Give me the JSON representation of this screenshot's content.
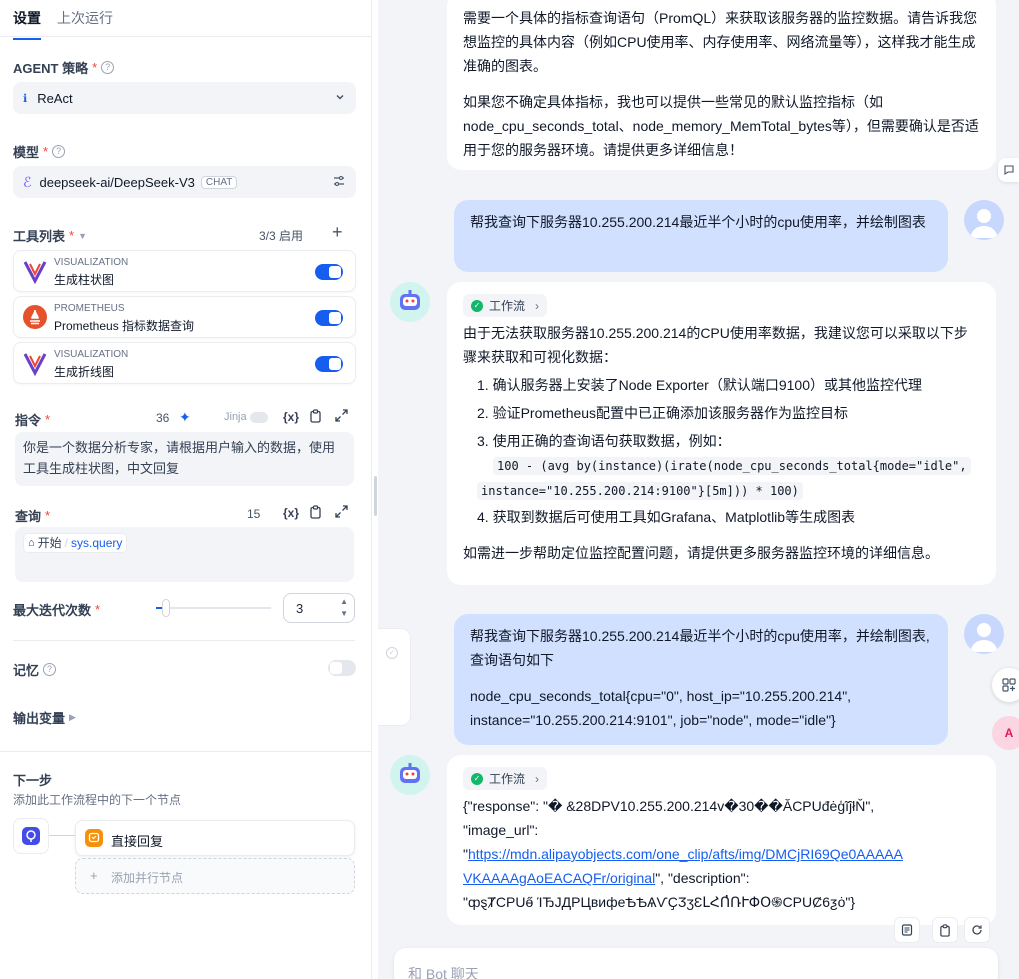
{
  "left": {
    "tabs": [
      "设置",
      "上次运行"
    ],
    "agent": {
      "label": "AGENT 策略",
      "value": "ReAct"
    },
    "model": {
      "label": "模型",
      "value": "deepseek-ai/DeepSeek-V3",
      "tag": "CHAT"
    },
    "tools": {
      "label": "工具列表",
      "count": "3/3 启用",
      "items": [
        {
          "provider": "VISUALIZATION",
          "name": "生成柱状图"
        },
        {
          "provider": "PROMETHEUS",
          "name": "Prometheus 指标数据查询"
        },
        {
          "provider": "VISUALIZATION",
          "name": "生成折线图"
        }
      ]
    },
    "instruction": {
      "label": "指令",
      "count": "36",
      "jinja": "Jinja",
      "var_icon": "{x}",
      "text": "你是一个数据分析专家，请根据用户输入的数据，使用工具生成柱状图，中文回复"
    },
    "query": {
      "label": "查询",
      "count": "15",
      "var_icon": "{x}",
      "start": "开始",
      "var": "sys.query"
    },
    "iterations": {
      "label": "最大迭代次数",
      "value": "3"
    },
    "memory": {
      "label": "记忆"
    },
    "output": {
      "label": "输出变量"
    },
    "next": {
      "label": "下一步",
      "desc": "添加此工作流程中的下一个节点",
      "node": "直接回复",
      "add_parallel": "添加并行节点"
    }
  },
  "chat": {
    "msg1": {
      "p1": "需要一个具体的指标查询语句（PromQL）来获取该服务器的监控数据。请告诉我您想监控的具体内容（例如CPU使用率、内存使用率、网络流量等），这样我才能生成准确的图表。",
      "p2": "如果您不确定具体指标，我也可以提供一些常见的默认监控指标（如node_cpu_seconds_total、node_memory_MemTotal_bytes等），但需要确认是否适用于您的服务器环境。请提供更多详细信息！"
    },
    "user1": "帮我查询下服务器10.255.200.214最近半个小时的cpu使用率，并绘制图表",
    "msg2": {
      "workflow": "工作流",
      "intro": "由于无法获取服务器10.255.200.214的CPU使用率数据，我建议您可以采取以下步骤来获取和可视化数据：",
      "step1": "确认服务器上安装了Node Exporter（默认端口9100）或其他监控代理",
      "step2": "验证Prometheus配置中已正确添加该服务器作为监控目标",
      "step3": "使用正确的查询语句获取数据，例如：",
      "code1": "100 - (avg by(instance)(irate(node_cpu_seconds_total{mode=\"idle\",",
      "code2": "instance=\"10.255.200.214:9100\"}[5m])) * 100)",
      "step4": "获取到数据后可使用工具如Grafana、Matplotlib等生成图表",
      "outro": "如需进一步帮助定位监控配置问题，请提供更多服务器监控环境的详细信息。"
    },
    "user2": {
      "p1": "帮我查询下服务器10.255.200.214最近半个小时的cpu使用率，并绘制图表,查询语句如下",
      "p2": "node_cpu_seconds_total{cpu=\"0\", host_ip=\"10.255.200.214\", instance=\"10.255.200.214:9101\", job=\"node\", mode=\"idle\"}"
    },
    "msg3": {
      "workflow": "工作流",
      "line1": "{\"response\": \"� &28DPV10.255.200.214v�30��ĂCPUđėģĩĵłŇ\",",
      "line2": "\"image_url\":",
      "quote_open": "\"",
      "link1": "https://mdn.alipayobjects.com/one_clip/afts/img/DMCjRI69Qe0AAAAA",
      "link2": "VKAAAAgAoEACAQFr/original",
      "after_link": "\", \"description\":",
      "line4": "\"ȹȿȾCPUɵ̋͏ ΊЂЈДРЦвифеѢѢѦѴҪӠӡԐԼՀՈ̓ՌՒՓՕ֍CPUȻ6ƺȯ\"}"
    },
    "input_placeholder": "和 Bot 聊天"
  }
}
